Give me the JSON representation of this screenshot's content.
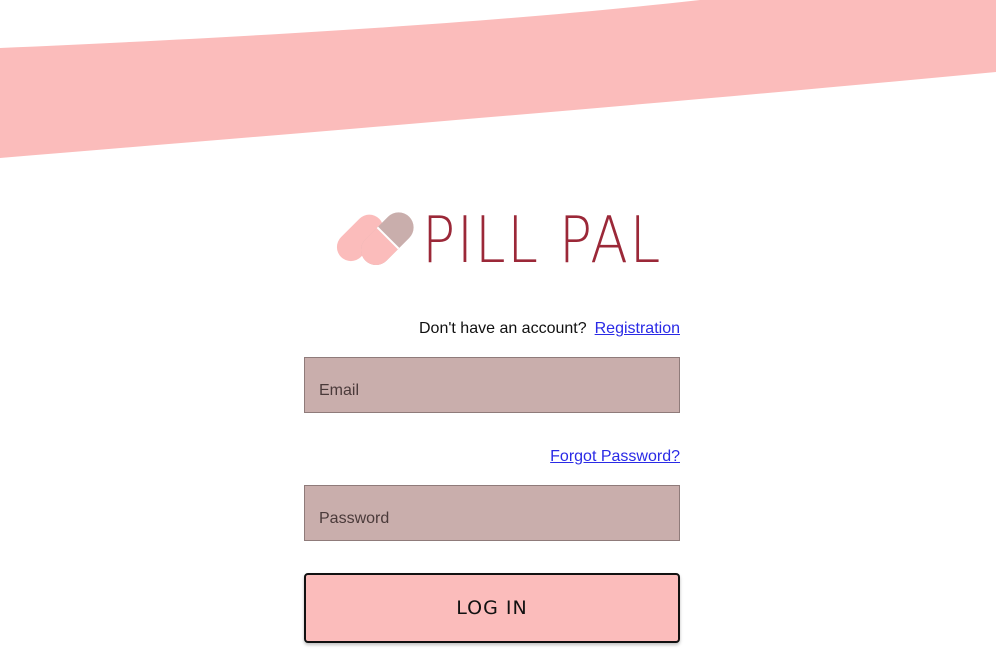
{
  "brand": {
    "name": "PILL PAL",
    "color": "#9b2838",
    "banner_color": "#fbbcbb",
    "logo_icon": "heart-pill-icon"
  },
  "login": {
    "account_prompt": "Don't have an account?",
    "registration_link": "Registration",
    "email_placeholder": "Email",
    "forgot_password_link": "Forgot Password?",
    "password_placeholder": "Password",
    "login_button": "LOG IN",
    "field_color": "#c9aeac",
    "link_color": "#2a2ae6"
  }
}
